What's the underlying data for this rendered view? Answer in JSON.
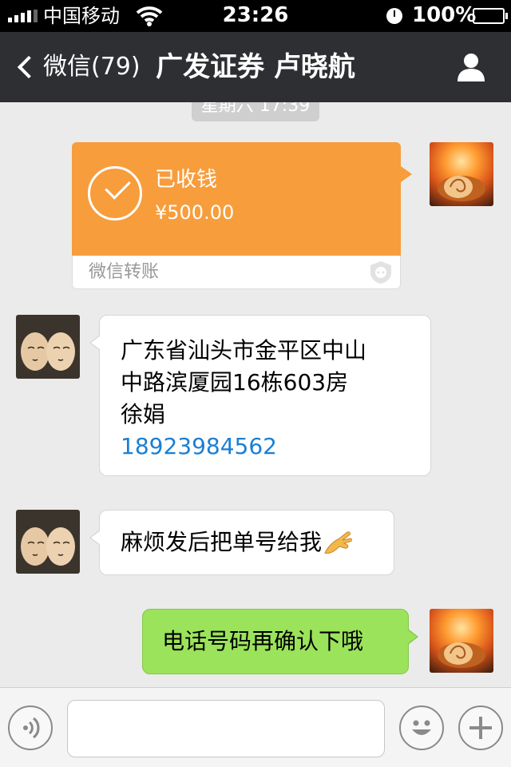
{
  "status_bar": {
    "carrier": "中国移动",
    "time": "23:26",
    "battery": "100%"
  },
  "nav": {
    "back_label": "微信(79)",
    "title": "广发证券 卢晓航"
  },
  "chat": {
    "timestamp": "星期六 17:39",
    "transfer": {
      "status": "已收钱",
      "amount": "¥500.00",
      "source": "微信转账"
    },
    "messages": [
      {
        "lines": [
          "广东省汕头市金平区中山",
          "中路滨厦园16栋603房",
          "徐娟"
        ],
        "phone": "18923984562"
      },
      {
        "text": "麻烦发后把单号给我"
      },
      {
        "text": "电话号码再确认下哦"
      }
    ]
  },
  "colors": {
    "nav_bg": "#2d2f32",
    "transfer_orange": "#f79d3c",
    "sent_green": "#9be35b",
    "phone_link": "#1a7fd4"
  },
  "icons": [
    "signal-icon",
    "wifi-icon",
    "clock-icon",
    "battery-icon",
    "back-chevron-icon",
    "person-icon",
    "check-icon",
    "shield-icon",
    "hand-emoji-icon",
    "voice-icon",
    "smiley-icon",
    "plus-icon"
  ]
}
